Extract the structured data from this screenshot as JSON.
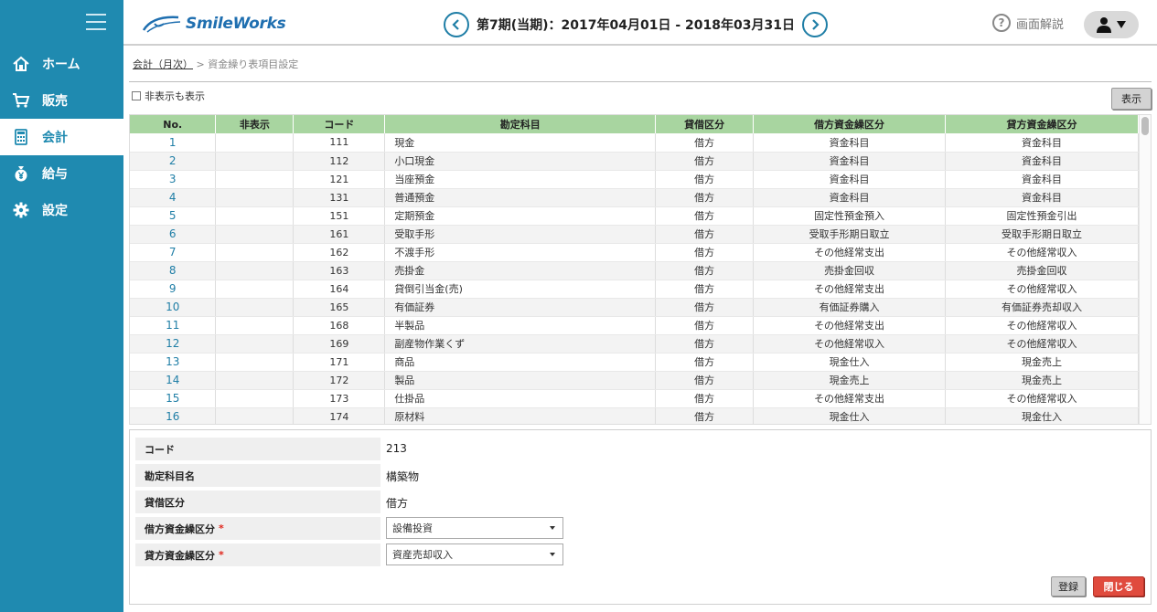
{
  "app": {
    "logo_text": "SmileWorks"
  },
  "header": {
    "period": "第7期(当期)：2017年04月01日 - 2018年03月31日",
    "help_label": "画面解説"
  },
  "sidebar": {
    "items": [
      {
        "label": "ホーム",
        "icon": "home-icon"
      },
      {
        "label": "販売",
        "icon": "cart-icon"
      },
      {
        "label": "会計",
        "icon": "calculator-icon",
        "active": true
      },
      {
        "label": "給与",
        "icon": "yen-bag-icon"
      },
      {
        "label": "設定",
        "icon": "gear-icon"
      }
    ]
  },
  "breadcrumb": {
    "parent": "会計（月次）",
    "separator": ">",
    "current": "資金繰り表項目設定"
  },
  "toolbar": {
    "show_hidden_label": "非表示も表示",
    "show_button": "表示"
  },
  "table": {
    "headers": [
      "No.",
      "非表示",
      "コード",
      "勘定科目",
      "貸借区分",
      "借方資金繰区分",
      "貸方資金繰区分"
    ],
    "rows": [
      [
        "1",
        "",
        "111",
        "現金",
        "借方",
        "資金科目",
        "資金科目"
      ],
      [
        "2",
        "",
        "112",
        "小口現金",
        "借方",
        "資金科目",
        "資金科目"
      ],
      [
        "3",
        "",
        "121",
        "当座預金",
        "借方",
        "資金科目",
        "資金科目"
      ],
      [
        "4",
        "",
        "131",
        "普通預金",
        "借方",
        "資金科目",
        "資金科目"
      ],
      [
        "5",
        "",
        "151",
        "定期預金",
        "借方",
        "固定性預金預入",
        "固定性預金引出"
      ],
      [
        "6",
        "",
        "161",
        "受取手形",
        "借方",
        "受取手形期日取立",
        "受取手形期日取立"
      ],
      [
        "7",
        "",
        "162",
        "不渡手形",
        "借方",
        "その他経常支出",
        "その他経常収入"
      ],
      [
        "8",
        "",
        "163",
        "売掛金",
        "借方",
        "売掛金回収",
        "売掛金回収"
      ],
      [
        "9",
        "",
        "164",
        "貸倒引当金(売)",
        "借方",
        "その他経常支出",
        "その他経常収入"
      ],
      [
        "10",
        "",
        "165",
        "有価証券",
        "借方",
        "有価証券購入",
        "有価証券売却収入"
      ],
      [
        "11",
        "",
        "168",
        "半製品",
        "借方",
        "その他経常支出",
        "その他経常収入"
      ],
      [
        "12",
        "",
        "169",
        "副産物作業くず",
        "借方",
        "その他経常収入",
        "その他経常収入"
      ],
      [
        "13",
        "",
        "171",
        "商品",
        "借方",
        "現金仕入",
        "現金売上"
      ],
      [
        "14",
        "",
        "172",
        "製品",
        "借方",
        "現金売上",
        "現金売上"
      ],
      [
        "15",
        "",
        "173",
        "仕掛品",
        "借方",
        "その他経常支出",
        "その他経常収入"
      ],
      [
        "16",
        "",
        "174",
        "原材料",
        "借方",
        "現金仕入",
        "現金仕入"
      ]
    ]
  },
  "detail": {
    "code_label": "コード",
    "code_value": "213",
    "account_label": "勘定科目名",
    "account_value": "構築物",
    "side_label": "貸借区分",
    "side_value": "借方",
    "debit_label": "借方資金繰区分",
    "debit_value": "設備投資",
    "credit_label": "貸方資金繰区分",
    "credit_value": "資産売却収入",
    "required_mark": "*"
  },
  "buttons": {
    "register": "登録",
    "close": "閉じる"
  },
  "colors": {
    "sidebar": "#1f8ab0",
    "table_header": "#a8d5a0",
    "close_button": "#e04b3e"
  }
}
